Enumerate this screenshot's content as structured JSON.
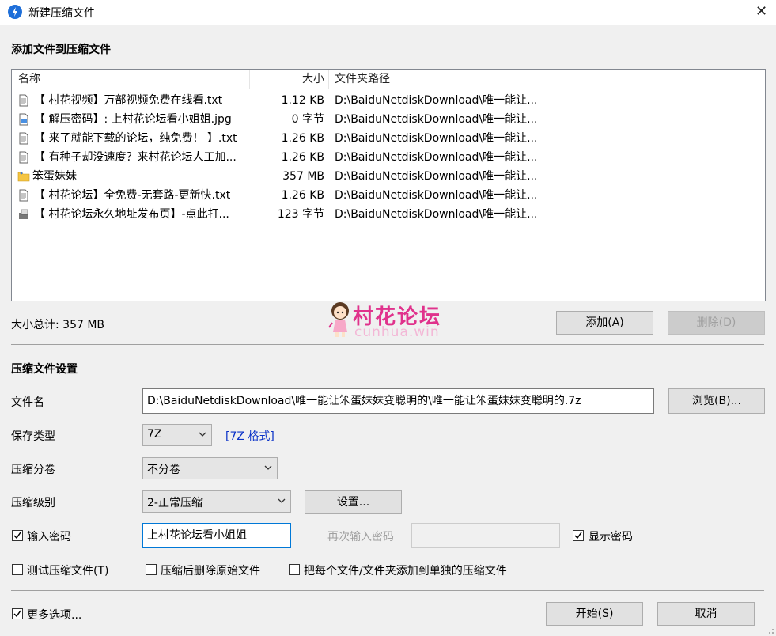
{
  "window": {
    "title": "新建压缩文件",
    "close_glyph": "✕",
    "icon": "bandizip-icon"
  },
  "files_section": {
    "title": "添加文件到压缩文件",
    "columns": [
      "名称",
      "大小",
      "文件夹路径"
    ],
    "rows": [
      {
        "icon": "text-file-icon",
        "name": "【 村花视频】万部视频免费在线看.txt",
        "size": "1.12 KB",
        "path": "D:\\BaiduNetdiskDownload\\唯一能让..."
      },
      {
        "icon": "image-file-icon",
        "name": "【 解压密码】: 上村花论坛看小姐姐.jpg",
        "size": "0 字节",
        "path": "D:\\BaiduNetdiskDownload\\唯一能让..."
      },
      {
        "icon": "text-file-icon",
        "name": "【 来了就能下载的论坛，纯免费！ 】.txt",
        "size": "1.26 KB",
        "path": "D:\\BaiduNetdiskDownload\\唯一能让..."
      },
      {
        "icon": "text-file-icon",
        "name": "【 有种子却没速度？来村花论坛人工加...",
        "size": "1.26 KB",
        "path": "D:\\BaiduNetdiskDownload\\唯一能让..."
      },
      {
        "icon": "folder-icon",
        "name": "笨蛋妹妹",
        "size": "357 MB",
        "path": "D:\\BaiduNetdiskDownload\\唯一能让..."
      },
      {
        "icon": "text-file-icon",
        "name": "【 村花论坛】全免费-无套路-更新快.txt",
        "size": "1.26 KB",
        "path": "D:\\BaiduNetdiskDownload\\唯一能让..."
      },
      {
        "icon": "shortcut-file-icon",
        "name": "【 村花论坛永久地址发布页】-点此打...",
        "size": "123 字节",
        "path": "D:\\BaiduNetdiskDownload\\唯一能让..."
      }
    ],
    "total_size": "大小总计: 357 MB",
    "add_button": "添加(A)",
    "delete_button": "删除(D)"
  },
  "watermark": {
    "text": "村花论坛",
    "sub": "cunhua.win"
  },
  "settings": {
    "title": "压缩文件设置",
    "filename_label": "文件名",
    "filename_value": "D:\\BaiduNetdiskDownload\\唯一能让笨蛋妹妹变聪明的\\唯一能让笨蛋妹妹变聪明的.7z",
    "browse_button": "浏览(B)...",
    "save_type_label": "保存类型",
    "save_type_value": "7Z",
    "format_link": "[7Z 格式]",
    "split_label": "压缩分卷",
    "split_value": "不分卷",
    "level_label": "压缩级别",
    "level_value": "2-正常压缩",
    "settings_button": "设置...",
    "password_checkbox_label": "输入密码",
    "password_checked": true,
    "password_value": "上村花论坛看小姐姐",
    "confirm_label": "再次输入密码",
    "confirm_value": "",
    "show_password_label": "显示密码",
    "show_password_checked": true,
    "test_label": "测试压缩文件(T)",
    "test_checked": false,
    "delete_after_label": "压缩后删除原始文件",
    "delete_after_checked": false,
    "separate_label": "把每个文件/文件夹添加到单独的压缩文件",
    "separate_checked": false
  },
  "footer": {
    "more_options_label": "更多选项...",
    "more_options_checked": true,
    "start_button": "开始(S)",
    "cancel_button": "取消"
  }
}
